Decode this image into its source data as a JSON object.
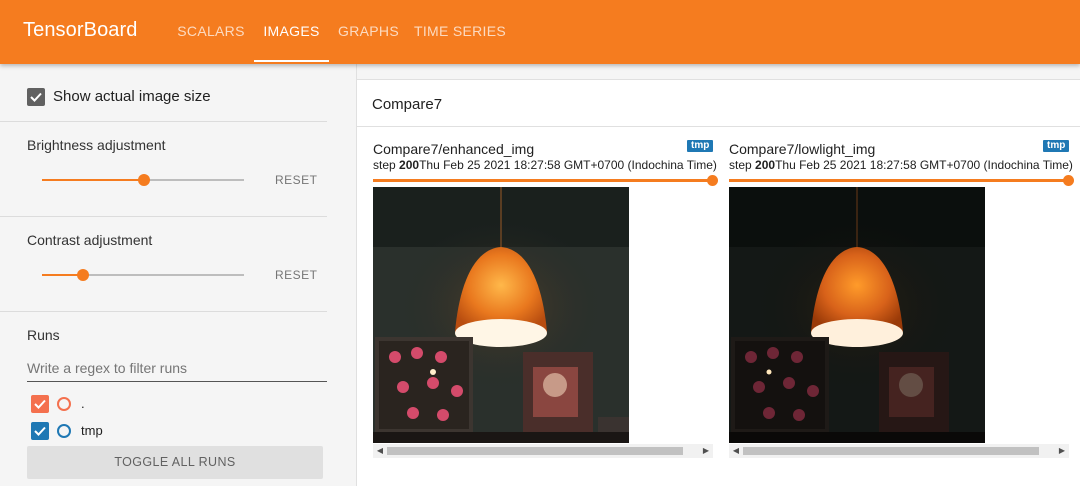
{
  "header": {
    "brand": "TensorBoard",
    "tabs": [
      {
        "label": "SCALARS",
        "active": false
      },
      {
        "label": "IMAGES",
        "active": true
      },
      {
        "label": "GRAPHS",
        "active": false
      },
      {
        "label": "TIME SERIES",
        "active": false
      }
    ],
    "color": "#f57c1f"
  },
  "sidebar": {
    "show_actual_size": {
      "label": "Show actual image size",
      "checked": true
    },
    "brightness": {
      "title": "Brightness adjustment",
      "value_fraction": 0.5,
      "reset_label": "RESET"
    },
    "contrast": {
      "title": "Contrast adjustment",
      "value_fraction": 0.2,
      "reset_label": "RESET"
    },
    "runs": {
      "title": "Runs",
      "filter_placeholder": "Write a regex to filter runs",
      "items": [
        {
          "name": ".",
          "checked": true,
          "color": "#f4704e"
        },
        {
          "name": "tmp",
          "checked": true,
          "color": "#1f78b4"
        }
      ],
      "toggle_all_label": "TOGGLE ALL RUNS"
    }
  },
  "main": {
    "group_title": "Compare7",
    "cards": [
      {
        "title": "Compare7/enhanced_img",
        "run": "tmp",
        "step_label": "step",
        "step": "200",
        "timestamp": "Thu Feb 25 2021 18:27:58 GMT+0700 (Indochina Time)",
        "brightness": "enhanced"
      },
      {
        "title": "Compare7/lowlight_img",
        "run": "tmp",
        "step_label": "step",
        "step": "200",
        "timestamp": "Thu Feb 25 2021 18:27:58 GMT+0700 (Indochina Time)",
        "brightness": "lowlight"
      }
    ]
  }
}
